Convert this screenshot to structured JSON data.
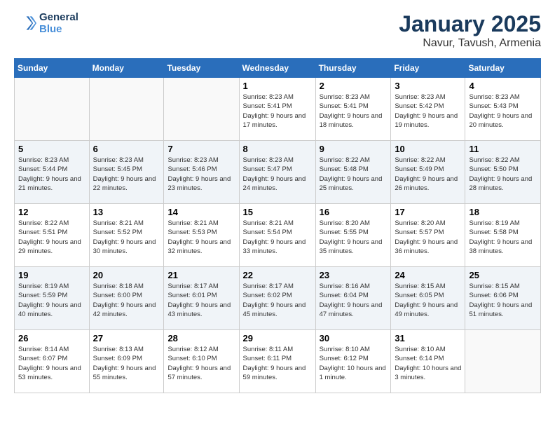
{
  "logo": {
    "line1": "General",
    "line2": "Blue"
  },
  "title": "January 2025",
  "location": "Navur, Tavush, Armenia",
  "days_of_week": [
    "Sunday",
    "Monday",
    "Tuesday",
    "Wednesday",
    "Thursday",
    "Friday",
    "Saturday"
  ],
  "weeks": [
    [
      {
        "day": "",
        "info": ""
      },
      {
        "day": "",
        "info": ""
      },
      {
        "day": "",
        "info": ""
      },
      {
        "day": "1",
        "info": "Sunrise: 8:23 AM\nSunset: 5:41 PM\nDaylight: 9 hours and 17 minutes."
      },
      {
        "day": "2",
        "info": "Sunrise: 8:23 AM\nSunset: 5:41 PM\nDaylight: 9 hours and 18 minutes."
      },
      {
        "day": "3",
        "info": "Sunrise: 8:23 AM\nSunset: 5:42 PM\nDaylight: 9 hours and 19 minutes."
      },
      {
        "day": "4",
        "info": "Sunrise: 8:23 AM\nSunset: 5:43 PM\nDaylight: 9 hours and 20 minutes."
      }
    ],
    [
      {
        "day": "5",
        "info": "Sunrise: 8:23 AM\nSunset: 5:44 PM\nDaylight: 9 hours and 21 minutes."
      },
      {
        "day": "6",
        "info": "Sunrise: 8:23 AM\nSunset: 5:45 PM\nDaylight: 9 hours and 22 minutes."
      },
      {
        "day": "7",
        "info": "Sunrise: 8:23 AM\nSunset: 5:46 PM\nDaylight: 9 hours and 23 minutes."
      },
      {
        "day": "8",
        "info": "Sunrise: 8:23 AM\nSunset: 5:47 PM\nDaylight: 9 hours and 24 minutes."
      },
      {
        "day": "9",
        "info": "Sunrise: 8:22 AM\nSunset: 5:48 PM\nDaylight: 9 hours and 25 minutes."
      },
      {
        "day": "10",
        "info": "Sunrise: 8:22 AM\nSunset: 5:49 PM\nDaylight: 9 hours and 26 minutes."
      },
      {
        "day": "11",
        "info": "Sunrise: 8:22 AM\nSunset: 5:50 PM\nDaylight: 9 hours and 28 minutes."
      }
    ],
    [
      {
        "day": "12",
        "info": "Sunrise: 8:22 AM\nSunset: 5:51 PM\nDaylight: 9 hours and 29 minutes."
      },
      {
        "day": "13",
        "info": "Sunrise: 8:21 AM\nSunset: 5:52 PM\nDaylight: 9 hours and 30 minutes."
      },
      {
        "day": "14",
        "info": "Sunrise: 8:21 AM\nSunset: 5:53 PM\nDaylight: 9 hours and 32 minutes."
      },
      {
        "day": "15",
        "info": "Sunrise: 8:21 AM\nSunset: 5:54 PM\nDaylight: 9 hours and 33 minutes."
      },
      {
        "day": "16",
        "info": "Sunrise: 8:20 AM\nSunset: 5:55 PM\nDaylight: 9 hours and 35 minutes."
      },
      {
        "day": "17",
        "info": "Sunrise: 8:20 AM\nSunset: 5:57 PM\nDaylight: 9 hours and 36 minutes."
      },
      {
        "day": "18",
        "info": "Sunrise: 8:19 AM\nSunset: 5:58 PM\nDaylight: 9 hours and 38 minutes."
      }
    ],
    [
      {
        "day": "19",
        "info": "Sunrise: 8:19 AM\nSunset: 5:59 PM\nDaylight: 9 hours and 40 minutes."
      },
      {
        "day": "20",
        "info": "Sunrise: 8:18 AM\nSunset: 6:00 PM\nDaylight: 9 hours and 42 minutes."
      },
      {
        "day": "21",
        "info": "Sunrise: 8:17 AM\nSunset: 6:01 PM\nDaylight: 9 hours and 43 minutes."
      },
      {
        "day": "22",
        "info": "Sunrise: 8:17 AM\nSunset: 6:02 PM\nDaylight: 9 hours and 45 minutes."
      },
      {
        "day": "23",
        "info": "Sunrise: 8:16 AM\nSunset: 6:04 PM\nDaylight: 9 hours and 47 minutes."
      },
      {
        "day": "24",
        "info": "Sunrise: 8:15 AM\nSunset: 6:05 PM\nDaylight: 9 hours and 49 minutes."
      },
      {
        "day": "25",
        "info": "Sunrise: 8:15 AM\nSunset: 6:06 PM\nDaylight: 9 hours and 51 minutes."
      }
    ],
    [
      {
        "day": "26",
        "info": "Sunrise: 8:14 AM\nSunset: 6:07 PM\nDaylight: 9 hours and 53 minutes."
      },
      {
        "day": "27",
        "info": "Sunrise: 8:13 AM\nSunset: 6:09 PM\nDaylight: 9 hours and 55 minutes."
      },
      {
        "day": "28",
        "info": "Sunrise: 8:12 AM\nSunset: 6:10 PM\nDaylight: 9 hours and 57 minutes."
      },
      {
        "day": "29",
        "info": "Sunrise: 8:11 AM\nSunset: 6:11 PM\nDaylight: 9 hours and 59 minutes."
      },
      {
        "day": "30",
        "info": "Sunrise: 8:10 AM\nSunset: 6:12 PM\nDaylight: 10 hours and 1 minute."
      },
      {
        "day": "31",
        "info": "Sunrise: 8:10 AM\nSunset: 6:14 PM\nDaylight: 10 hours and 3 minutes."
      },
      {
        "day": "",
        "info": ""
      }
    ]
  ]
}
